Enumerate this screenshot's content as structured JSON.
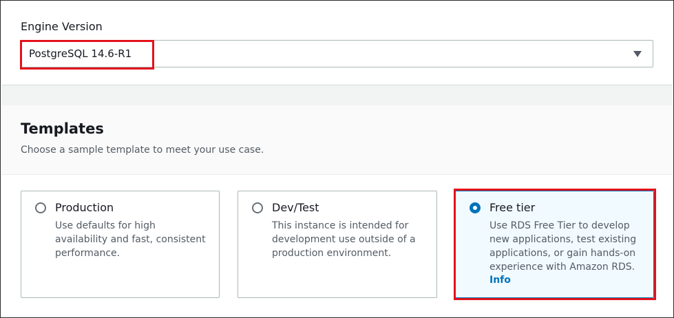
{
  "engine": {
    "label": "Engine Version",
    "selected": "PostgreSQL 14.6-R1"
  },
  "templates": {
    "title": "Templates",
    "description": "Choose a sample template to meet your use case.",
    "options": [
      {
        "title": "Production",
        "description": "Use defaults for high availability and fast, consistent performance.",
        "selected": false
      },
      {
        "title": "Dev/Test",
        "description": "This instance is intended for development use outside of a production environment.",
        "selected": false
      },
      {
        "title": "Free tier",
        "description": "Use RDS Free Tier to develop new applications, test existing applications, or gain hands-on experience with Amazon RDS.",
        "link": "Info",
        "selected": true
      }
    ]
  },
  "colors": {
    "highlight": "#e3121b",
    "accent": "#0073bb"
  }
}
